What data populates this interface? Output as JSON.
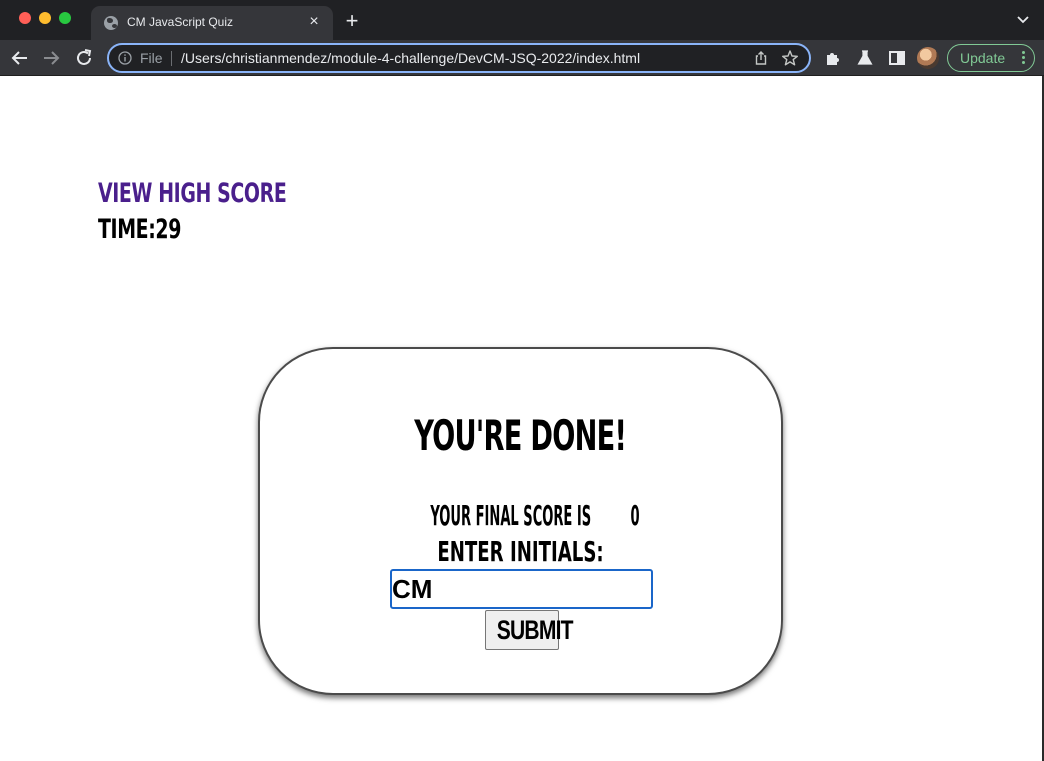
{
  "browser": {
    "tab_title": "CM JavaScript Quiz",
    "file_label": "File",
    "url": "/Users/christianmendez/module-4-challenge/DevCM-JSQ-2022/index.html",
    "update_label": "Update",
    "icons": [
      "back-icon",
      "forward-icon",
      "reload-icon",
      "info-icon",
      "share-icon",
      "star-icon",
      "extensions-icon",
      "labs-icon",
      "side-panel-icon",
      "tab-search-icon"
    ],
    "colors": {
      "chrome_dark": "#202124",
      "toolbar": "#35363a",
      "focus_ring": "#8ab4f8",
      "update_green": "#81c995"
    }
  },
  "header": {
    "view_high_score": "View High Score",
    "timer_label": "Time:",
    "timer_value": "29"
  },
  "result_card": {
    "title": "You're Done!",
    "final_score_text": "Your final score is",
    "final_score": "0",
    "initials_label": "Enter Initials:",
    "initials_value": "CM",
    "submit_label": "Submit"
  },
  "colors": {
    "link_purple": "#4a1f8c",
    "input_border": "#1a66c9"
  }
}
